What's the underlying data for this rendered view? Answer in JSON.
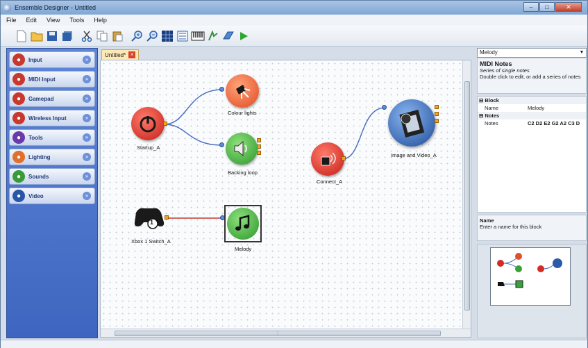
{
  "window": {
    "title": "Ensemble Designer - Untitled"
  },
  "menu": [
    "File",
    "Edit",
    "View",
    "Tools",
    "Help"
  ],
  "toolbar_icons": [
    "new-icon",
    "open-icon",
    "save-icon",
    "save-all-icon",
    "cut-icon",
    "copy-icon",
    "paste-icon",
    "zoom-in-icon",
    "zoom-out-icon",
    "grid-icon",
    "list-icon",
    "keyboard-icon",
    "midi-icon",
    "blocks-icon",
    "run-icon"
  ],
  "palette": [
    {
      "label": "Input",
      "color": "#c8382c",
      "icon": "input-icon"
    },
    {
      "label": "MIDI Input",
      "color": "#c8382c",
      "icon": "midi-input-icon"
    },
    {
      "label": "Gamepad",
      "color": "#c8382c",
      "icon": "gamepad-icon"
    },
    {
      "label": "Wireless Input",
      "color": "#c8382c",
      "icon": "wireless-icon"
    },
    {
      "label": "Tools",
      "color": "#6a3aa8",
      "icon": "tools-icon"
    },
    {
      "label": "Lighting",
      "color": "#e0702a",
      "icon": "lighting-icon"
    },
    {
      "label": "Sounds",
      "color": "#3a9a3a",
      "icon": "sounds-icon"
    },
    {
      "label": "Video",
      "color": "#2a56a8",
      "icon": "video-icon"
    }
  ],
  "doc_tab": {
    "label": "Untitled*",
    "close": "×"
  },
  "nodes": {
    "startup": {
      "label": "Startup_A",
      "color": "#d42b23"
    },
    "colour_lights": {
      "label": "Colour lights",
      "color": "#e0502a"
    },
    "backing_loop": {
      "label": "Backing loop",
      "color": "#3aa03a"
    },
    "connect": {
      "label": "Connect_A",
      "color": "#d42b23"
    },
    "image_video": {
      "label": "Image and Video_A",
      "color": "#2a5aa8"
    },
    "xbox": {
      "label": "Xbox 1 Switch_A",
      "badge": "1"
    },
    "melody": {
      "label": "Melody",
      "color": "#3aa03a"
    }
  },
  "properties": {
    "selector": "Melody",
    "title": "MIDI Notes",
    "subtitle": "Series of single notes",
    "hint": "Double click to edit, or add a series of notes",
    "categories": [
      {
        "name": "Block",
        "rows": [
          {
            "key": "Name",
            "value": "Melody"
          }
        ]
      },
      {
        "name": "Notes",
        "rows": [
          {
            "key": "Notes",
            "value": "C2 D2 E2 G2 A2 C3 D"
          }
        ]
      }
    ],
    "help_title": "Name",
    "help_text": "Enter a name for this block"
  },
  "colors": {
    "accent": "#3e66c0",
    "wire_blue": "#4a6fc0",
    "wire_red": "#c0382c"
  }
}
